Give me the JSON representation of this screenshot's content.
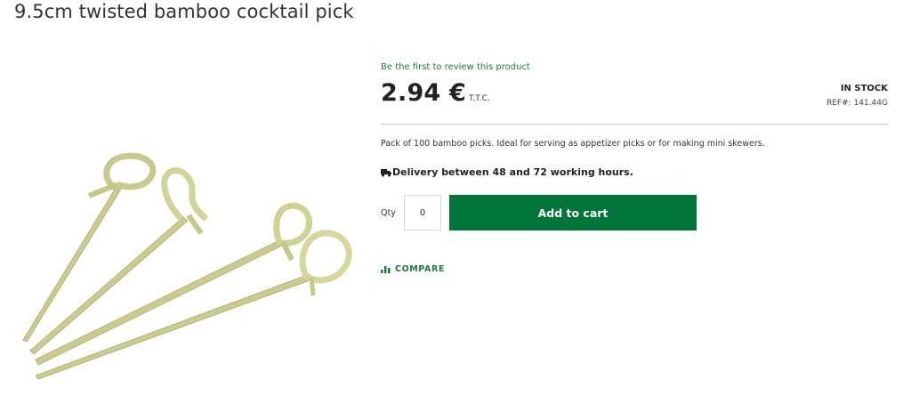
{
  "product": {
    "title": "9.5cm twisted bamboo cocktail pick",
    "review_link": "Be the first to review this product",
    "price": "2.94 €",
    "tax_label": "T.T.C.",
    "stock_status": "IN STOCK",
    "reference": "REF#:  141.44G",
    "description": "Pack of 100 bamboo picks. Ideal for serving as appetizer picks or for making mini skewers.",
    "delivery": "Delivery between 48 and 72 working hours."
  },
  "cart": {
    "qty_label": "Qty",
    "qty_value": "0",
    "add_to_cart_label": "Add to cart"
  },
  "compare": {
    "label": "COMPARE",
    "icon": "bar-chart-icon"
  },
  "icons": {
    "delivery": "truck-icon"
  },
  "colors": {
    "accent_green": "#00753a",
    "link_green": "#1e7b3c",
    "bamboo": "#cfd193"
  }
}
